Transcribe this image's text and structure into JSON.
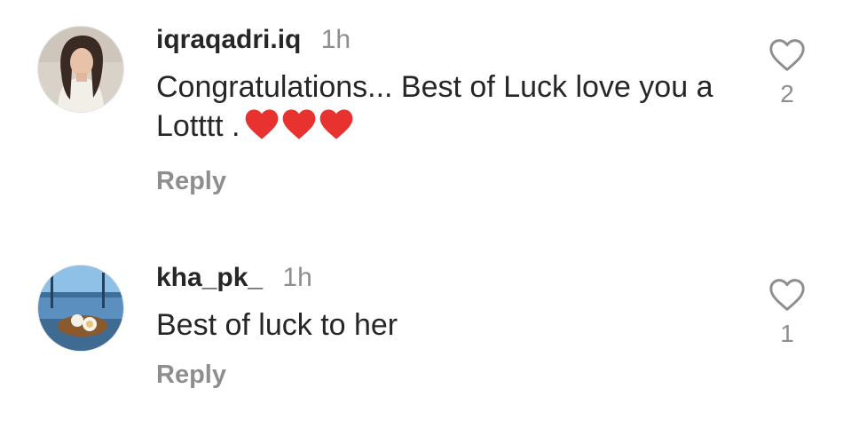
{
  "comments": [
    {
      "username": "iqraqadri.iq",
      "time": "1h",
      "text": "Congratulations... Best of Luck love you a Lotttt .",
      "emoji": [
        "red-heart",
        "red-heart",
        "red-heart"
      ],
      "reply_label": "Reply",
      "likes": "2",
      "avatar_icon": "profile-photo"
    },
    {
      "username": "kha_pk_",
      "time": "1h",
      "text": "Best of luck to her",
      "reply_label": "Reply",
      "likes": "1",
      "avatar_icon": "profile-photo"
    }
  ],
  "colors": {
    "text": "#262626",
    "muted": "#8e8e8e",
    "heart_emoji": "#e8322f",
    "like_outline": "#8e8e8e"
  }
}
